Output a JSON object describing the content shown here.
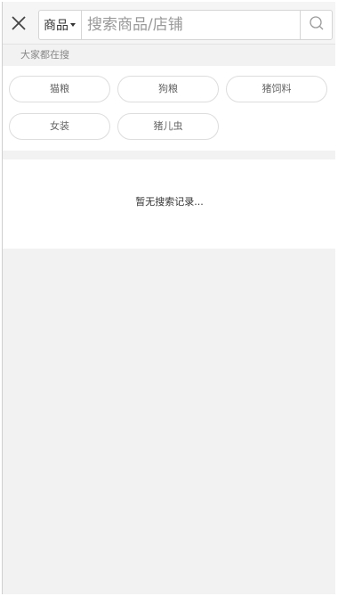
{
  "search": {
    "category_label": "商品",
    "placeholder": "搜索商品/店铺"
  },
  "hot": {
    "label": "大家都在搜",
    "tags": [
      "猫粮",
      "狗粮",
      "猪饲料",
      "女装",
      "猪儿虫"
    ]
  },
  "history": {
    "empty_text": "暂无搜索记录..."
  },
  "icons": {
    "close": "close-icon",
    "search": "search-icon",
    "caret": "chevron-down-icon"
  },
  "colors": {
    "page_background": "#f2f2f2",
    "panel_background": "#ffffff",
    "border": "#dddddd",
    "muted_text": "#888888"
  }
}
